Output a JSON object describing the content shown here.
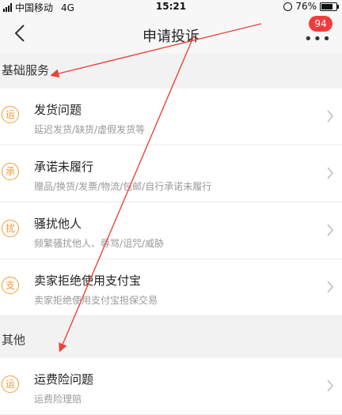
{
  "status_bar": {
    "carrier": "中国移动",
    "network": "4G",
    "time": "15:21",
    "battery": "76%"
  },
  "nav": {
    "title": "申请投诉",
    "more_badge": "94"
  },
  "sections": [
    {
      "header": "基础服务",
      "items": [
        {
          "icon": "运",
          "title": "发货问题",
          "subtitle": "延迟发货/缺货/虚假发货等"
        },
        {
          "icon": "承",
          "title": "承诺未履行",
          "subtitle": "赠品/换货/发票/物流/包邮/自行承诺未履行"
        },
        {
          "icon": "扰",
          "title": "骚扰他人",
          "subtitle": "频繁骚扰他人、辱骂/诅咒/威胁"
        },
        {
          "icon": "支",
          "title": "卖家拒绝使用支付宝",
          "subtitle": "卖家拒绝使用支付宝担保交易"
        }
      ]
    },
    {
      "header": "其他",
      "items": [
        {
          "icon": "运",
          "title": "运费险问题",
          "subtitle": "运费险理赔"
        }
      ]
    }
  ],
  "colors": {
    "accent": "#f59a35",
    "badge": "#f43b3b",
    "annotation": "#e8453c"
  }
}
